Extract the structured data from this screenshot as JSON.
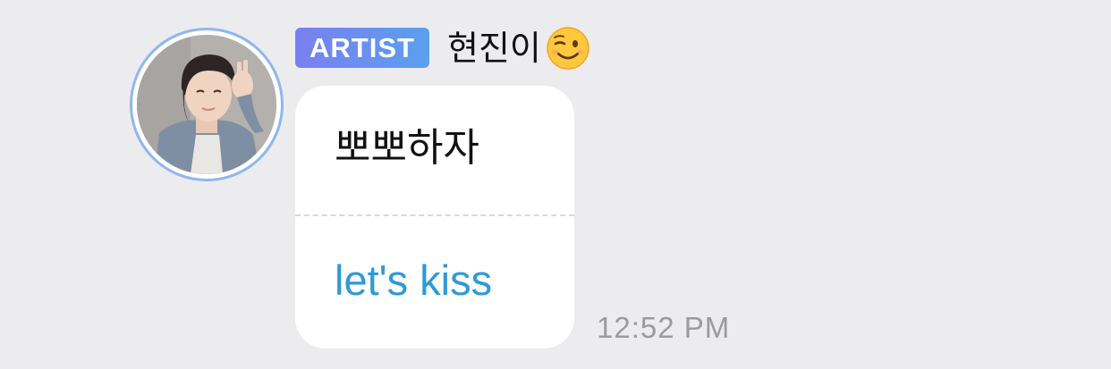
{
  "message": {
    "badge": "ARTIST",
    "sender_name": "현진이",
    "name_emoji_icon": "winking-face-icon",
    "original_text": "뽀뽀하자",
    "translation_text": "let's kiss",
    "timestamp": "12:52 PM"
  },
  "colors": {
    "background": "#ececee",
    "bubble": "#ffffff",
    "badge_gradient_start": "#7a7ff0",
    "badge_gradient_end": "#5aa0ee",
    "avatar_ring": "#8fb7ee",
    "translation_text": "#2e9ad8",
    "timestamp_text": "#9a9a9f"
  }
}
